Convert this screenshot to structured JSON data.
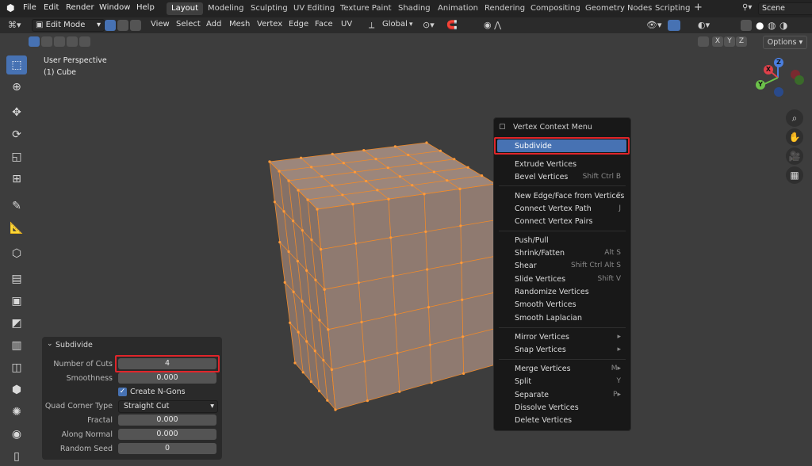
{
  "topbar": {
    "menus": [
      "File",
      "Edit",
      "Render",
      "Window",
      "Help"
    ],
    "workspaces": [
      "Layout",
      "Modeling",
      "Sculpting",
      "UV Editing",
      "Texture Paint",
      "Shading",
      "Animation",
      "Rendering",
      "Compositing",
      "Geometry Nodes",
      "Scripting"
    ],
    "active_workspace": "Layout",
    "scene_name": "Scene"
  },
  "header": {
    "mode": "Edit Mode",
    "menus": [
      "View",
      "Select",
      "Add",
      "Mesh",
      "Vertex",
      "Edge",
      "Face",
      "UV"
    ],
    "orientation": "Global",
    "axes": [
      "X",
      "Y",
      "Z"
    ],
    "options_label": "Options"
  },
  "viewport": {
    "perspective_label": "User Perspective",
    "object_label": "(1) Cube"
  },
  "gizmo": {
    "x": "X",
    "y": "Y",
    "z": "Z"
  },
  "context_menu": {
    "title": "Vertex Context Menu",
    "items": [
      {
        "label": "Subdivide",
        "shortcut": "",
        "highlighted": true
      },
      {
        "label": "Extrude Vertices",
        "shortcut": ""
      },
      {
        "label": "Bevel Vertices",
        "shortcut": "Shift Ctrl B"
      },
      {
        "label": "New Edge/Face from Vertices",
        "shortcut": "F"
      },
      {
        "label": "Connect Vertex Path",
        "shortcut": "J"
      },
      {
        "label": "Connect Vertex Pairs",
        "shortcut": ""
      },
      {
        "label": "Push/Pull",
        "shortcut": ""
      },
      {
        "label": "Shrink/Fatten",
        "shortcut": "Alt S"
      },
      {
        "label": "Shear",
        "shortcut": "Shift Ctrl Alt S"
      },
      {
        "label": "Slide Vertices",
        "shortcut": "Shift V"
      },
      {
        "label": "Randomize Vertices",
        "shortcut": ""
      },
      {
        "label": "Smooth Vertices",
        "shortcut": ""
      },
      {
        "label": "Smooth Laplacian",
        "shortcut": ""
      },
      {
        "label": "Mirror Vertices",
        "shortcut": "▸"
      },
      {
        "label": "Snap Vertices",
        "shortcut": "▸"
      },
      {
        "label": "Merge Vertices",
        "shortcut": "M▸"
      },
      {
        "label": "Split",
        "shortcut": "Y"
      },
      {
        "label": "Separate",
        "shortcut": "P▸"
      },
      {
        "label": "Dissolve Vertices",
        "shortcut": ""
      },
      {
        "label": "Delete Vertices",
        "shortcut": ""
      }
    ]
  },
  "operator_panel": {
    "title": "Subdivide",
    "number_of_cuts_label": "Number of Cuts",
    "number_of_cuts": "4",
    "smoothness_label": "Smoothness",
    "smoothness": "0.000",
    "create_ngons_label": "Create N-Gons",
    "create_ngons": true,
    "quad_corner_type_label": "Quad Corner Type",
    "quad_corner_type": "Straight Cut",
    "fractal_label": "Fractal",
    "fractal": "0.000",
    "along_normal_label": "Along Normal",
    "along_normal": "0.000",
    "random_seed_label": "Random Seed",
    "random_seed": "0"
  },
  "colors": {
    "accent": "#4772b3",
    "highlight_box": "#e0252a",
    "mesh_face": "#8f7a70",
    "mesh_edge": "#f08a2a"
  }
}
